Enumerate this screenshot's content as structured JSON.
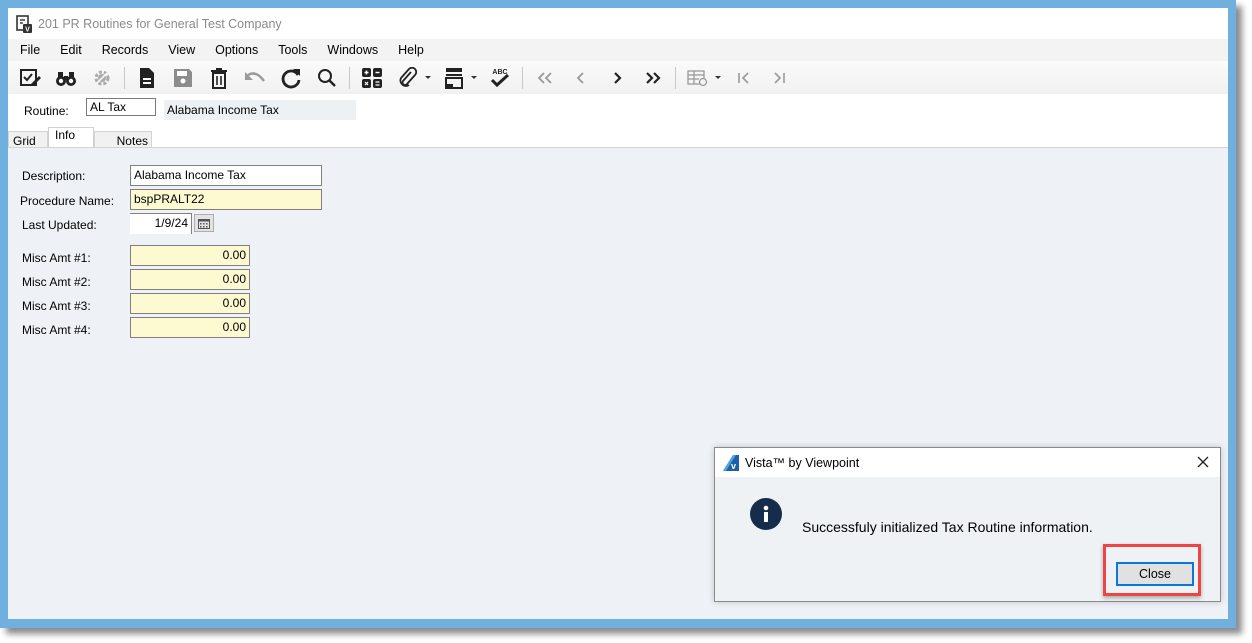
{
  "window": {
    "title": "201 PR Routines for General Test Company",
    "app_icon": "form-document-icon"
  },
  "menu": {
    "items": [
      "File",
      "Edit",
      "Records",
      "View",
      "Options",
      "Tools",
      "Windows",
      "Help"
    ]
  },
  "toolbar": {
    "buttons": [
      {
        "name": "edit-checklist-icon",
        "enabled": true
      },
      {
        "name": "binoculars-find-icon",
        "enabled": true
      },
      {
        "name": "gear-settings-icon",
        "enabled": false
      },
      {
        "name": "new-record-icon",
        "enabled": true
      },
      {
        "name": "save-icon",
        "enabled": false
      },
      {
        "name": "delete-trash-icon",
        "enabled": true
      },
      {
        "name": "undo-icon",
        "enabled": false
      },
      {
        "name": "refresh-icon",
        "enabled": true
      },
      {
        "name": "search-icon",
        "enabled": true
      },
      {
        "name": "calculator-icon",
        "enabled": true
      },
      {
        "name": "attachment-paperclip-icon",
        "enabled": true
      },
      {
        "name": "print-icon",
        "enabled": true
      },
      {
        "name": "spellcheck-abc-icon",
        "enabled": true
      },
      {
        "name": "first-record-icon",
        "enabled": false
      },
      {
        "name": "previous-record-icon",
        "enabled": false
      },
      {
        "name": "next-record-icon",
        "enabled": true
      },
      {
        "name": "last-record-icon",
        "enabled": true
      },
      {
        "name": "grid-settings-icon",
        "enabled": false
      },
      {
        "name": "first-page-icon",
        "enabled": false
      },
      {
        "name": "last-page-icon",
        "enabled": false
      }
    ]
  },
  "header": {
    "routine_label": "Routine:",
    "routine_value": "AL Tax",
    "routine_description": "Alabama Income Tax"
  },
  "tabs": [
    {
      "label": "Grid",
      "active": false
    },
    {
      "label": "Info",
      "active": true
    },
    {
      "label": "Notes",
      "active": false
    }
  ],
  "form": {
    "description": {
      "label": "Description:",
      "value": "Alabama Income Tax"
    },
    "procedure_name": {
      "label": "Procedure Name:",
      "value": "bspPRALT22"
    },
    "last_updated": {
      "label": "Last Updated:",
      "value": "1/9/24"
    },
    "misc_amounts": [
      {
        "label": "Misc Amt #1:",
        "value": "0.00"
      },
      {
        "label": "Misc Amt #2:",
        "value": "0.00"
      },
      {
        "label": "Misc Amt #3:",
        "value": "0.00"
      },
      {
        "label": "Misc Amt #4:",
        "value": "0.00"
      }
    ]
  },
  "dialog": {
    "title": "Vista™ by Viewpoint",
    "icon": "info-icon",
    "message": "Successfuly initialized Tax Routine information.",
    "close_button": "Close",
    "highlight_color": "#ee4444"
  },
  "colors": {
    "frame": "#6fb0df",
    "background": "#eef2f6",
    "required_field": "#fdfad2",
    "focus_border": "#0a78d7"
  }
}
